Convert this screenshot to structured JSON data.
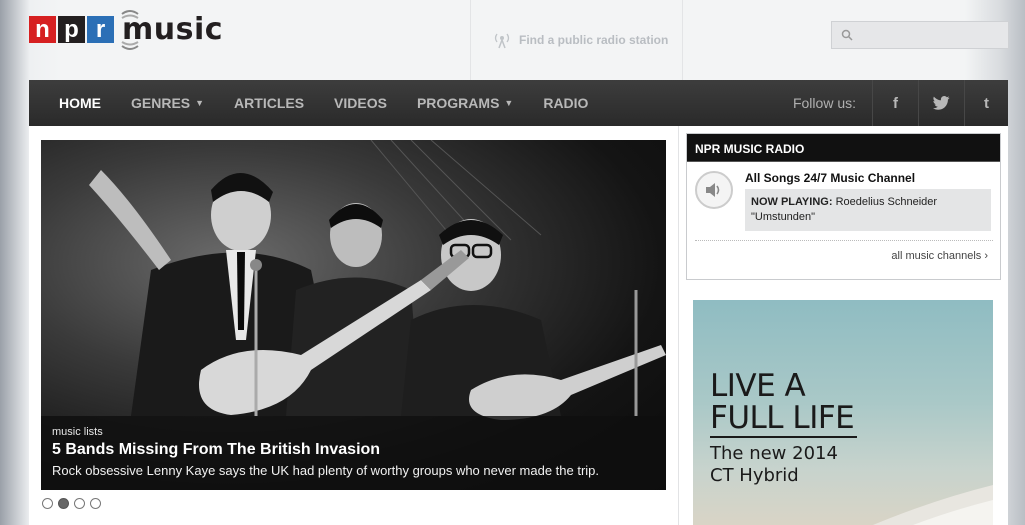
{
  "header": {
    "logo": {
      "npr_letters": [
        "n",
        "p",
        "r"
      ],
      "word": "music"
    },
    "find_station": "Find a public radio station",
    "search": {
      "placeholder": "",
      "value": ""
    }
  },
  "nav": {
    "items": [
      {
        "label": "HOME",
        "active": true,
        "dropdown": false
      },
      {
        "label": "GENRES",
        "active": false,
        "dropdown": true
      },
      {
        "label": "ARTICLES",
        "active": false,
        "dropdown": false
      },
      {
        "label": "VIDEOS",
        "active": false,
        "dropdown": false
      },
      {
        "label": "PROGRAMS",
        "active": false,
        "dropdown": true
      },
      {
        "label": "RADIO",
        "active": false,
        "dropdown": false
      }
    ],
    "follow_label": "Follow us:",
    "social": [
      "f",
      "twitter-icon",
      "t"
    ]
  },
  "hero": {
    "kicker": "music lists",
    "title": "5 Bands Missing From The British Invasion",
    "teaser": "Rock obsessive Lenny Kaye says the UK had plenty of worthy groups who never made the trip.",
    "slides": 4,
    "active_slide": 2
  },
  "radio_widget": {
    "heading": "NPR MUSIC RADIO",
    "channel": "All Songs 24/7 Music Channel",
    "now_playing_label": "NOW PLAYING:",
    "now_playing_value": "Roedelius Schneider \"Umstunden\"",
    "all_channels": "all music channels"
  },
  "ad": {
    "headline_line1": "LIVE A",
    "headline_line2": "FULL LIFE",
    "sub_line1": "The new 2014",
    "sub_line2": "CT Hybrid"
  },
  "colors": {
    "npr_red": "#d62021",
    "npr_black": "#231f20",
    "npr_blue": "#2b6fb6",
    "nav_bg": "#333333"
  }
}
